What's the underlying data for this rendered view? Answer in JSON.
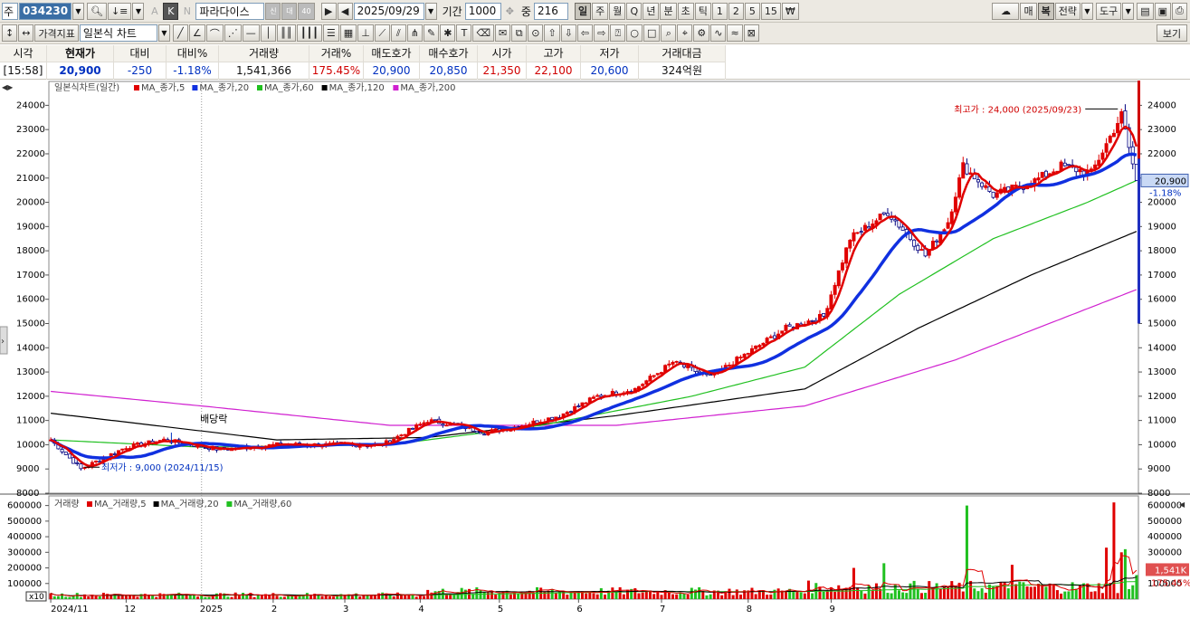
{
  "toolbar1": {
    "market": "주",
    "code": "034230",
    "name": "파라다이스",
    "date": "2025/09/29",
    "period_label": "기간",
    "period": "1000",
    "count_label": "중",
    "count": "216",
    "intervals": [
      "일",
      "주",
      "월",
      "Q",
      "년",
      "분",
      "초",
      "틱",
      "1",
      "2",
      "5",
      "15",
      "₩"
    ],
    "right_buttons": [
      "매",
      "복",
      "전략",
      "도구"
    ]
  },
  "toolbar2": {
    "indicator_btn": "가격지표",
    "chart_type": "일본식 차트",
    "view_btn": "보기"
  },
  "quote": {
    "headers": [
      "시각",
      "현재가",
      "대비",
      "대비%",
      "거래량",
      "거래%",
      "매도호가",
      "매수호가",
      "시가",
      "고가",
      "저가",
      "거래대금"
    ],
    "values": [
      "[15:58]",
      "20,900",
      "-250",
      "-1.18%",
      "1,541,366",
      "175.45%",
      "20,900",
      "20,850",
      "21,350",
      "22,100",
      "20,600",
      "324억원"
    ]
  },
  "chart": {
    "price_legend_title": "일본식차트(일간)",
    "price_legend_items": [
      {
        "name": "MA_종가,5",
        "color": "#e00000"
      },
      {
        "name": "MA_종가,20",
        "color": "#1030e0"
      },
      {
        "name": "MA_종가,60",
        "color": "#20c020"
      },
      {
        "name": "MA_종가,120",
        "color": "#000000"
      },
      {
        "name": "MA_종가,200",
        "color": "#d020d0"
      }
    ],
    "volume_legend_title": "거래량",
    "volume_legend_items": [
      {
        "name": "MA_거래량,5",
        "color": "#e00000"
      },
      {
        "name": "MA_거래량,20",
        "color": "#000000"
      },
      {
        "name": "MA_거래량,60",
        "color": "#20c020"
      }
    ],
    "high_annotation": "최고가 : 24,000 (2025/09/23)",
    "low_annotation": "최저가 : 9,000 (2024/11/15)",
    "dividend_label": "배당락",
    "last_price_label": "20,900",
    "last_change_label": "-1.18%",
    "last_volume_label": "1,541K",
    "last_volume_pct_label": "175.45%",
    "volume_multiplier": "x10",
    "price_axis_ticks": [
      "24000",
      "23000",
      "22000",
      "21000",
      "20000",
      "19000",
      "18000",
      "17000",
      "16000",
      "15000",
      "14000",
      "13000",
      "12000",
      "11000",
      "10000",
      "9000",
      "8000"
    ],
    "volume_axis_ticks": [
      "600000",
      "500000",
      "400000",
      "300000",
      "200000",
      "100000"
    ],
    "x_axis_labels": [
      "2024/11",
      "12",
      "2025",
      "2",
      "3",
      "4",
      "5",
      "6",
      "7",
      "8",
      "9"
    ]
  },
  "chart_data": {
    "type": "candlestick",
    "title": "일본식차트(일간)",
    "ylim": [
      8000,
      24500
    ],
    "volume_ylim": [
      0,
      650000
    ],
    "months": [
      "2024/11",
      "12",
      "2025",
      "2",
      "3",
      "4",
      "5",
      "6",
      "7",
      "8",
      "9"
    ],
    "price_path": [
      {
        "i": 0,
        "close": 10200
      },
      {
        "i": 8,
        "close": 9000
      },
      {
        "i": 20,
        "close": 9900
      },
      {
        "i": 30,
        "close": 10200
      },
      {
        "i": 45,
        "close": 9800
      },
      {
        "i": 60,
        "close": 10000
      },
      {
        "i": 75,
        "close": 10000
      },
      {
        "i": 88,
        "close": 10000
      },
      {
        "i": 100,
        "close": 11000
      },
      {
        "i": 108,
        "close": 10800
      },
      {
        "i": 115,
        "close": 10500
      },
      {
        "i": 125,
        "close": 10800
      },
      {
        "i": 135,
        "close": 11200
      },
      {
        "i": 145,
        "close": 12000
      },
      {
        "i": 155,
        "close": 12300
      },
      {
        "i": 165,
        "close": 13400
      },
      {
        "i": 175,
        "close": 12800
      },
      {
        "i": 185,
        "close": 13800
      },
      {
        "i": 195,
        "close": 14800
      },
      {
        "i": 205,
        "close": 15300
      },
      {
        "i": 212,
        "close": 18500
      },
      {
        "i": 222,
        "close": 19600
      },
      {
        "i": 232,
        "close": 17800
      },
      {
        "i": 238,
        "close": 19200
      },
      {
        "i": 242,
        "close": 21500
      },
      {
        "i": 250,
        "close": 20300
      },
      {
        "i": 260,
        "close": 20800
      },
      {
        "i": 268,
        "close": 21500
      },
      {
        "i": 276,
        "close": 21200
      },
      {
        "i": 281,
        "close": 22700
      },
      {
        "i": 284,
        "close": 23600
      },
      {
        "i": 288,
        "close": 20900
      }
    ],
    "ma60_path": [
      {
        "i": 0,
        "v": 10200
      },
      {
        "i": 40,
        "v": 9900
      },
      {
        "i": 90,
        "v": 10000
      },
      {
        "i": 130,
        "v": 10800
      },
      {
        "i": 170,
        "v": 12000
      },
      {
        "i": 200,
        "v": 13200
      },
      {
        "i": 225,
        "v": 16200
      },
      {
        "i": 250,
        "v": 18500
      },
      {
        "i": 275,
        "v": 20000
      },
      {
        "i": 288,
        "v": 20900
      }
    ],
    "ma120_path": [
      {
        "i": 0,
        "v": 11300
      },
      {
        "i": 60,
        "v": 10200
      },
      {
        "i": 100,
        "v": 10300
      },
      {
        "i": 150,
        "v": 11200
      },
      {
        "i": 200,
        "v": 12300
      },
      {
        "i": 230,
        "v": 14800
      },
      {
        "i": 260,
        "v": 17000
      },
      {
        "i": 288,
        "v": 18800
      }
    ],
    "ma200_path": [
      {
        "i": 0,
        "v": 12200
      },
      {
        "i": 40,
        "v": 11600
      },
      {
        "i": 90,
        "v": 10800
      },
      {
        "i": 150,
        "v": 10800
      },
      {
        "i": 200,
        "v": 11600
      },
      {
        "i": 240,
        "v": 13500
      },
      {
        "i": 288,
        "v": 16400
      }
    ],
    "high": {
      "value": 24000,
      "date": "2025/09/23"
    },
    "low": {
      "value": 9000,
      "date": "2024/11/15"
    },
    "last": {
      "price": 20900,
      "change_pct": -1.18,
      "volume": 1541366,
      "volume_pct": 175.45
    },
    "volume_spikes": [
      {
        "i": 243,
        "v": 600000
      },
      {
        "i": 282,
        "v": 620000
      },
      {
        "i": 280,
        "v": 330000
      },
      {
        "i": 284,
        "v": 300000
      },
      {
        "i": 285,
        "v": 320000
      },
      {
        "i": 221,
        "v": 230000
      },
      {
        "i": 213,
        "v": 200000
      },
      {
        "i": 255,
        "v": 220000
      }
    ]
  }
}
